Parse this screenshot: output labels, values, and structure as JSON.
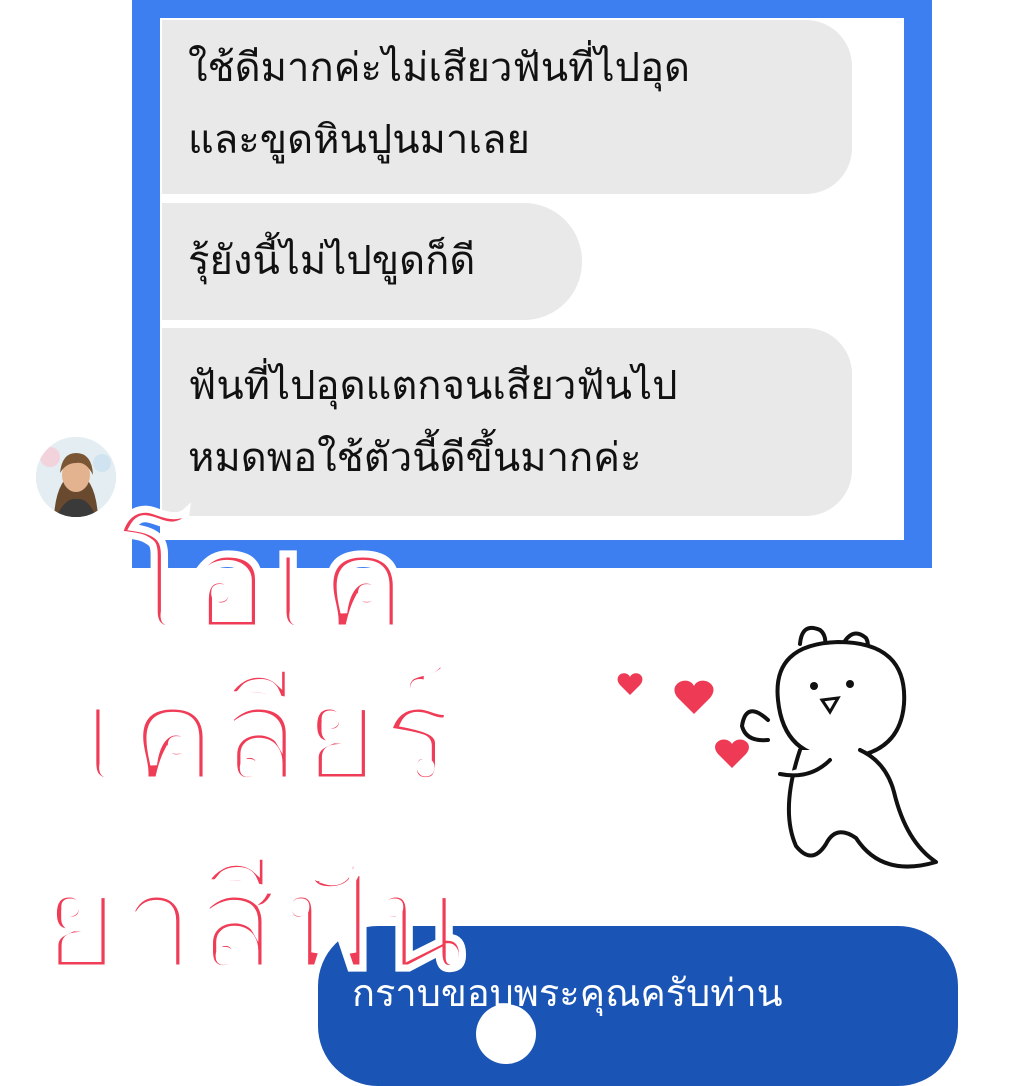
{
  "chat": {
    "messages": [
      {
        "lines": [
          "ใช้ดีมากค่ะไม่เสียวฟันที่ไปอุด",
          "และขูดหินปูนมาเลย"
        ]
      },
      {
        "lines": [
          "รุ้ยังนี้ไม่ไปขูดก็ดี"
        ]
      },
      {
        "lines": [
          "ฟันที่ไปอุดแตกจนเสียวฟันไป",
          "หมดพอใช้ตัวนี้ดีขึ้นมากค่ะ"
        ]
      }
    ]
  },
  "overlay": {
    "line1": "โอเค",
    "line2": "เคลียร์",
    "line3": "ยาสีฟัน"
  },
  "footer": {
    "text": "กราบขอบพระคุณครับท่าน"
  },
  "colors": {
    "frame": "#3d7ef0",
    "bubble": "#e9e9ea",
    "overlay_text": "#ef3c57",
    "footer_pill": "#1a55b5",
    "heart": "#ee3a55"
  },
  "icons": {
    "avatar": "user-avatar-photo",
    "sticker": "bunny-sticker",
    "hearts": "heart-icon"
  }
}
